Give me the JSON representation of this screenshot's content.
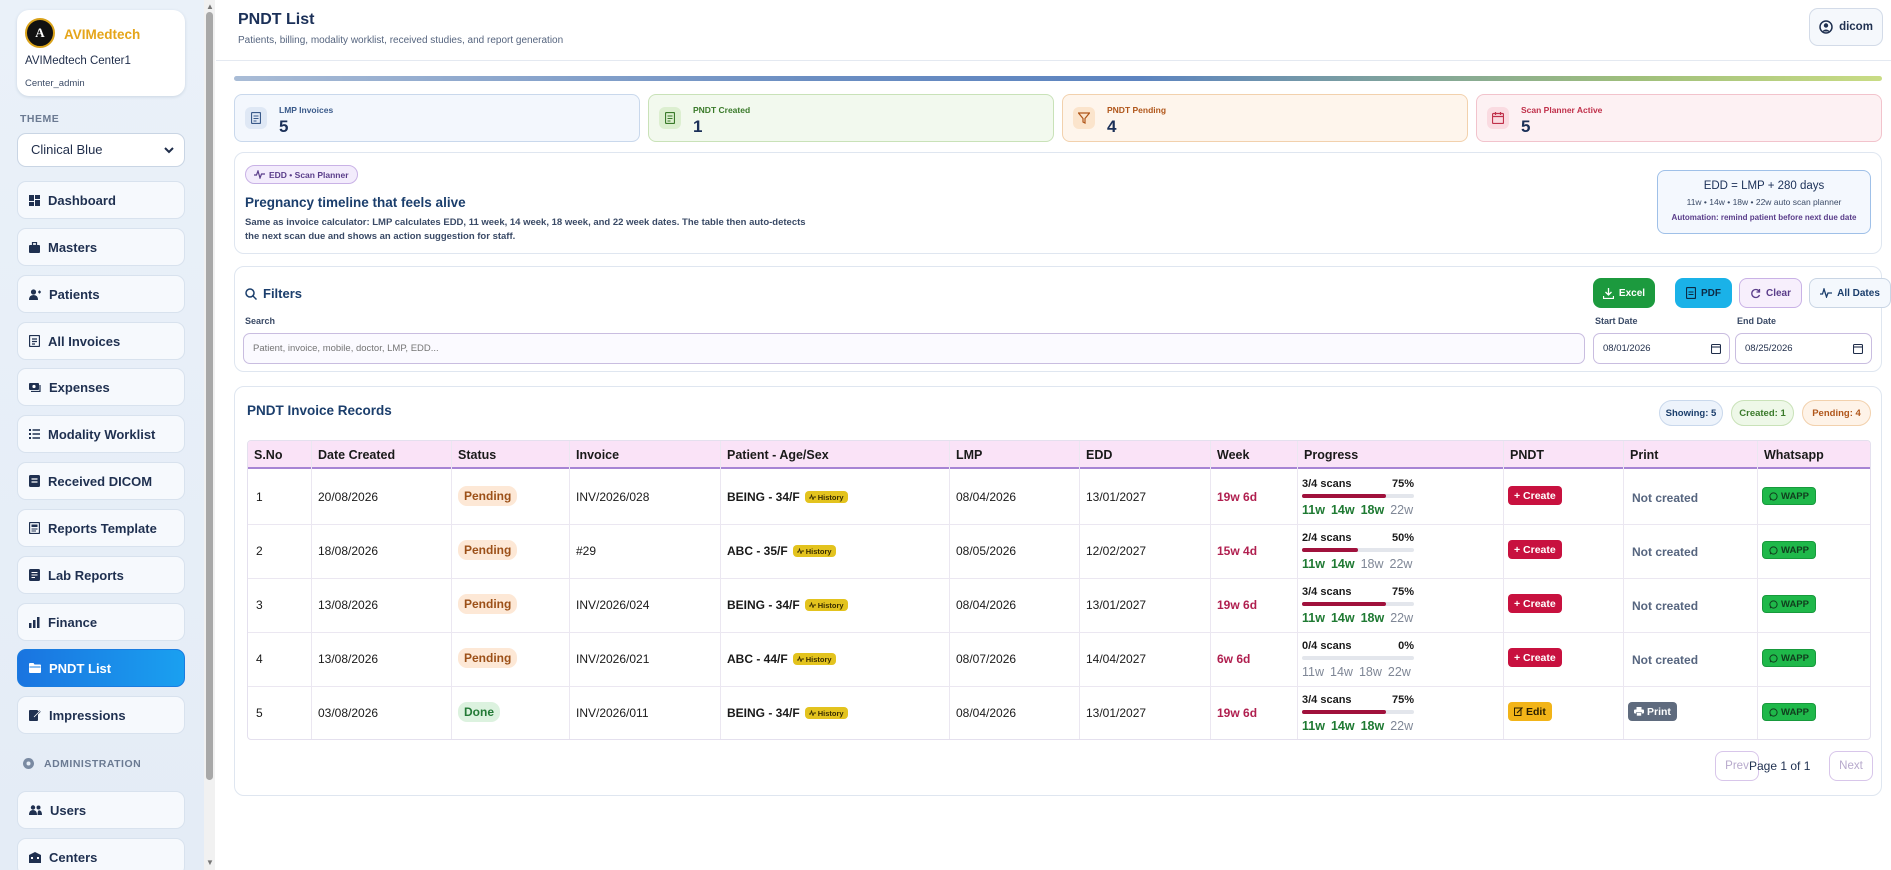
{
  "brand": {
    "name": "AVIMedtech",
    "logo_letter": "A",
    "center": "AVIMedtech Center1",
    "role": "Center_admin"
  },
  "theme": {
    "label": "THEME",
    "selected": "Clinical Blue"
  },
  "nav": [
    {
      "label": "Dashboard",
      "icon": "dashboard-icon"
    },
    {
      "label": "Masters",
      "icon": "briefcase-icon"
    },
    {
      "label": "Patients",
      "icon": "user-icon"
    },
    {
      "label": "All Invoices",
      "icon": "invoice-icon"
    },
    {
      "label": "Expenses",
      "icon": "money-icon"
    },
    {
      "label": "Modality Worklist",
      "icon": "list-icon"
    },
    {
      "label": "Received DICOM",
      "icon": "file-icon"
    },
    {
      "label": "Reports Template",
      "icon": "template-icon"
    },
    {
      "label": "Lab Reports",
      "icon": "lab-icon"
    },
    {
      "label": "Finance",
      "icon": "chart-icon"
    },
    {
      "label": "PNDT List",
      "icon": "folder-icon",
      "active": true
    },
    {
      "label": "Impressions",
      "icon": "edit-icon"
    }
  ],
  "admin": {
    "label": "ADMINISTRATION",
    "items": [
      {
        "label": "Users"
      },
      {
        "label": "Centers"
      }
    ]
  },
  "header": {
    "title": "PNDT List",
    "subtitle": "Patients, billing, modality worklist, received studies, and report generation",
    "user": "dicom"
  },
  "stats": [
    {
      "label": "LMP Invoices",
      "value": "5",
      "color": "#3a5a8a"
    },
    {
      "label": "PNDT Created",
      "value": "1",
      "color": "#3a7a2a"
    },
    {
      "label": "PNDT Pending",
      "value": "4",
      "color": "#b0561a"
    },
    {
      "label": "Scan Planner Active",
      "value": "5",
      "color": "#c0304a"
    }
  ],
  "timeline": {
    "tag": "EDD • Scan Planner",
    "title": "Pregnancy timeline that feels alive",
    "desc": "Same as invoice calculator: LMP calculates EDD, 11 week, 14 week, 18 week, and 22 week dates. The table then auto-detects the next scan due and shows an action suggestion for staff.",
    "formula": "EDD = LMP + 280 days",
    "planner": "11w • 14w • 18w • 22w auto scan planner",
    "automation": "Automation: remind patient before next due date"
  },
  "filters": {
    "title": "Filters",
    "excel": "Excel",
    "pdf": "PDF",
    "clear": "Clear",
    "all_dates": "All Dates",
    "search_label": "Search",
    "search_placeholder": "Patient, invoice, mobile, doctor, LMP, EDD...",
    "start_label": "Start Date",
    "start_value": "08/01/2026",
    "end_label": "End Date",
    "end_value": "08/25/2026"
  },
  "records": {
    "title": "PNDT Invoice Records",
    "showing": "Showing: 5",
    "created": "Created: 1",
    "pending": "Pending: 4",
    "columns": [
      "S.No",
      "Date Created",
      "Status",
      "Invoice",
      "Patient - Age/Sex",
      "LMP",
      "EDD",
      "Week",
      "Progress",
      "PNDT",
      "Print",
      "Whatsapp"
    ],
    "history_label": "History",
    "weeks": [
      "11w",
      "14w",
      "18w",
      "22w"
    ],
    "rows": [
      {
        "sno": "1",
        "date": "20/08/2026",
        "status": "Pending",
        "invoice": "INV/2026/028",
        "patient": "BEING - 34/F",
        "lmp": "08/04/2026",
        "edd": "13/01/2027",
        "week": "19w 6d",
        "scans": "3/4 scans",
        "pct": "75%",
        "progress": 0.75,
        "done_weeks": 3,
        "pndt": "+ Create",
        "print": "Not created",
        "wapp": "WAPP"
      },
      {
        "sno": "2",
        "date": "18/08/2026",
        "status": "Pending",
        "invoice": "#29",
        "patient": "ABC - 35/F",
        "lmp": "08/05/2026",
        "edd": "12/02/2027",
        "week": "15w 4d",
        "scans": "2/4 scans",
        "pct": "50%",
        "progress": 0.5,
        "done_weeks": 2,
        "pndt": "+ Create",
        "print": "Not created",
        "wapp": "WAPP"
      },
      {
        "sno": "3",
        "date": "13/08/2026",
        "status": "Pending",
        "invoice": "INV/2026/024",
        "patient": "BEING - 34/F",
        "lmp": "08/04/2026",
        "edd": "13/01/2027",
        "week": "19w 6d",
        "scans": "3/4 scans",
        "pct": "75%",
        "progress": 0.75,
        "done_weeks": 3,
        "pndt": "+ Create",
        "print": "Not created",
        "wapp": "WAPP"
      },
      {
        "sno": "4",
        "date": "13/08/2026",
        "status": "Pending",
        "invoice": "INV/2026/021",
        "patient": "ABC - 44/F",
        "lmp": "08/07/2026",
        "edd": "14/04/2027",
        "week": "6w 6d",
        "scans": "0/4 scans",
        "pct": "0%",
        "progress": 0,
        "done_weeks": 0,
        "pndt": "+ Create",
        "print": "Not created",
        "wapp": "WAPP"
      },
      {
        "sno": "5",
        "date": "03/08/2026",
        "status": "Done",
        "invoice": "INV/2026/011",
        "patient": "BEING - 34/F",
        "lmp": "08/04/2026",
        "edd": "13/01/2027",
        "week": "19w 6d",
        "scans": "3/4 scans",
        "pct": "75%",
        "progress": 0.75,
        "done_weeks": 3,
        "pndt": "Edit",
        "print": "Print",
        "wapp": "WAPP"
      }
    ]
  },
  "pager": {
    "prev": "Prev",
    "text": "Page 1 of 1",
    "next": "Next"
  }
}
